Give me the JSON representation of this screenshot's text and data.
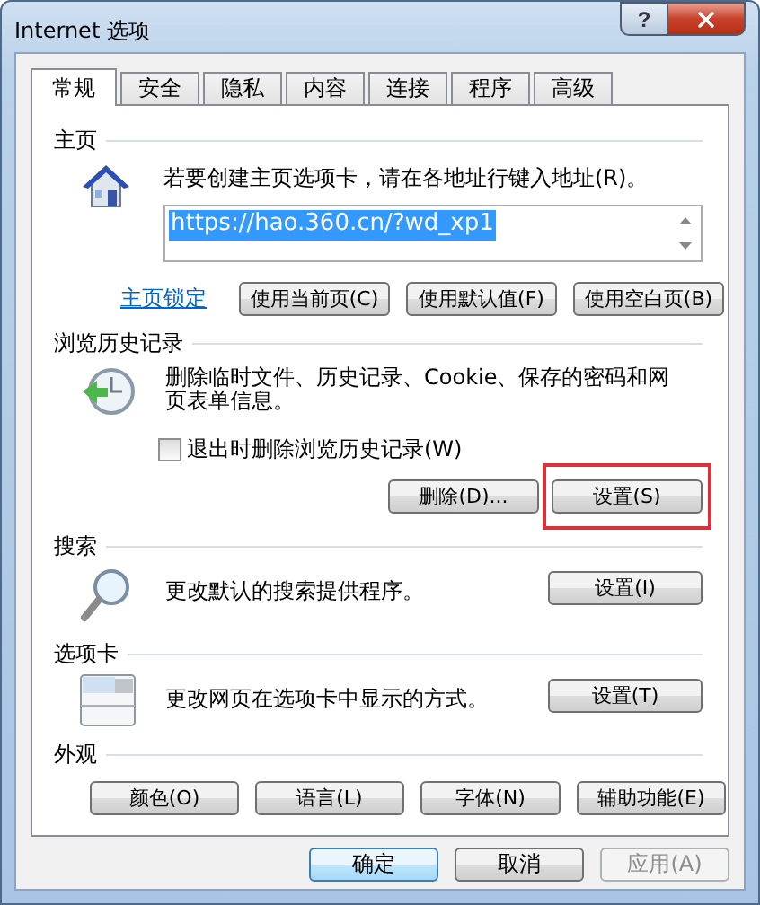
{
  "window": {
    "title": "Internet 选项",
    "help_button": "?"
  },
  "tabs": [
    {
      "label": "常规",
      "selected": true
    },
    {
      "label": "安全",
      "selected": false
    },
    {
      "label": "隐私",
      "selected": false
    },
    {
      "label": "内容",
      "selected": false
    },
    {
      "label": "连接",
      "selected": false
    },
    {
      "label": "程序",
      "selected": false
    },
    {
      "label": "高级",
      "selected": false
    }
  ],
  "homepage": {
    "heading": "主页",
    "description": "若要创建主页选项卡，请在各地址行键入地址(R)。",
    "address": {
      "value": "https://hao.360.cn/?wd_xp1",
      "highlighted": true
    },
    "lock_link": "主页锁定",
    "buttons": [
      {
        "label": "使用当前页(C)",
        "highlighted": false
      },
      {
        "label": "使用默认值(F)",
        "highlighted": false
      },
      {
        "label": "使用空白页(B)",
        "highlighted": false
      }
    ]
  },
  "browsing_history": {
    "heading": "浏览历史记录",
    "description": "删除临时文件、历史记录、Cookie、保存的密码和网页表单信息。",
    "checkbox": {
      "label": "退出时删除浏览历史记录(W)",
      "checked": false
    },
    "buttons": [
      {
        "label": "删除(D)...",
        "highlighted": false
      },
      {
        "label": "设置(S)",
        "highlighted": true
      }
    ]
  },
  "search": {
    "heading": "搜索",
    "description": "更改默认的搜索提供程序。",
    "button": {
      "label": "设置(I)",
      "highlighted": false
    }
  },
  "tabs_section": {
    "heading": "选项卡",
    "description": "更改网页在选项卡中显示的方式。",
    "button": {
      "label": "设置(T)",
      "highlighted": false
    }
  },
  "appearance": {
    "heading": "外观",
    "buttons": [
      {
        "label": "颜色(O)",
        "highlighted": false
      },
      {
        "label": "语言(L)",
        "highlighted": false
      },
      {
        "label": "字体(N)",
        "highlighted": false
      },
      {
        "label": "辅助功能(E)",
        "highlighted": false
      }
    ]
  },
  "dialog_buttons": [
    {
      "label": "确定",
      "default": true,
      "disabled": false
    },
    {
      "label": "取消",
      "default": false,
      "disabled": false
    },
    {
      "label": "应用(A)",
      "default": false,
      "disabled": true
    }
  ]
}
